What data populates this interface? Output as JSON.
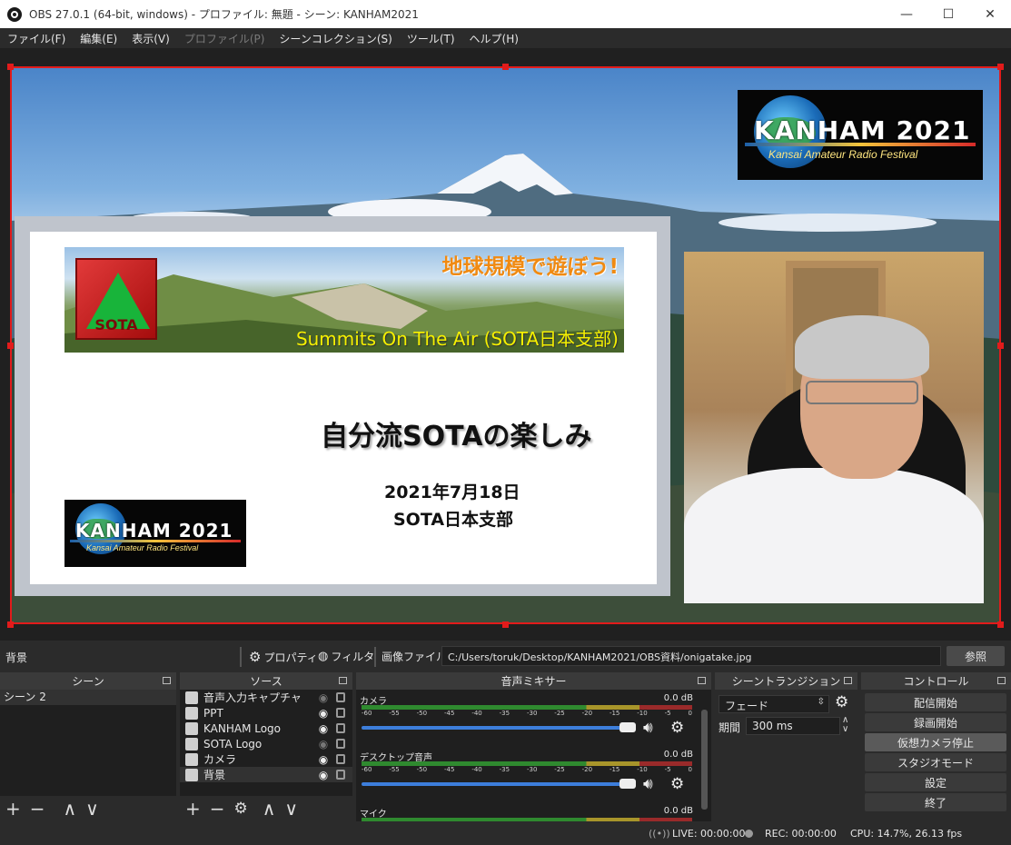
{
  "window": {
    "title": "OBS 27.0.1 (64-bit, windows) - プロファイル: 無題 - シーン: KANHAM2021",
    "minimize": "—",
    "maximize": "☐",
    "close": "✕"
  },
  "menu": [
    {
      "label": "ファイル(F)",
      "disabled": false
    },
    {
      "label": "編集(E)",
      "disabled": false
    },
    {
      "label": "表示(V)",
      "disabled": false
    },
    {
      "label": "プロファイル(P)",
      "disabled": true
    },
    {
      "label": "シーンコレクション(S)",
      "disabled": false
    },
    {
      "label": "ツール(T)",
      "disabled": false
    },
    {
      "label": "ヘルプ(H)",
      "disabled": false
    }
  ],
  "preview": {
    "logo_top": {
      "title": "KANHAM 2021",
      "subtitle": "Kansai Amateur Radio Festival"
    },
    "slide": {
      "slogan": "地球規模で遊ぼう!",
      "banner_sub": "Summits On The Air (SOTA日本支部)",
      "badge": "SOTA",
      "title": "自分流SOTAの楽しみ",
      "date": "2021年7月18日",
      "org": "SOTA日本支部",
      "logo_title": "KANHAM 2021",
      "logo_subtitle": "Kansai Amateur Radio Festival"
    }
  },
  "source_toolbar": {
    "selected_source": "背景",
    "properties": "プロパティ",
    "filters": "フィルタ",
    "image_file_label": "画像ファイル",
    "image_path": "C:/Users/toruk/Desktop/KANHAM2021/OBS資料/onigatake.jpg",
    "browse": "参照"
  },
  "docks": {
    "scenes": {
      "title": "シーン",
      "items": [
        "シーン 2"
      ]
    },
    "sources": {
      "title": "ソース",
      "items": [
        {
          "label": "音声入力キャプチャ",
          "icon": "microphone-icon",
          "visible": false
        },
        {
          "label": "PPT",
          "icon": "window-capture-icon",
          "visible": true
        },
        {
          "label": "KANHAM Logo",
          "icon": "image-icon",
          "visible": true
        },
        {
          "label": "SOTA Logo",
          "icon": "image-icon",
          "visible": false
        },
        {
          "label": "カメラ",
          "icon": "camera-icon",
          "visible": true
        },
        {
          "label": "背景",
          "icon": "image-icon",
          "visible": true
        }
      ]
    },
    "mixer": {
      "title": "音声ミキサー",
      "channels": [
        {
          "name": "カメラ",
          "db": "0.0 dB"
        },
        {
          "name": "デスクトップ音声",
          "db": "0.0 dB"
        },
        {
          "name": "マイク",
          "db": "0.0 dB"
        }
      ],
      "ticks": [
        "-60",
        "-55",
        "-50",
        "-45",
        "-40",
        "-35",
        "-30",
        "-25",
        "-20",
        "-15",
        "-10",
        "-5",
        "0"
      ]
    },
    "transitions": {
      "title": "シーントランジション",
      "type": "フェード",
      "duration_label": "期間",
      "duration": "300 ms"
    },
    "controls": {
      "title": "コントロール",
      "buttons": [
        {
          "label": "配信開始",
          "active": false
        },
        {
          "label": "録画開始",
          "active": false
        },
        {
          "label": "仮想カメラ停止",
          "active": true
        },
        {
          "label": "スタジオモード",
          "active": false
        },
        {
          "label": "設定",
          "active": false
        },
        {
          "label": "終了",
          "active": false
        }
      ]
    }
  },
  "status": {
    "live": "LIVE: 00:00:00",
    "rec": "REC: 00:00:00",
    "cpu": "CPU: 14.7%, 26.13 fps"
  },
  "colors": {
    "accent_red": "#e21b1b",
    "slider_blue": "#3d7edb",
    "panel_bg": "#2b2b2b"
  }
}
